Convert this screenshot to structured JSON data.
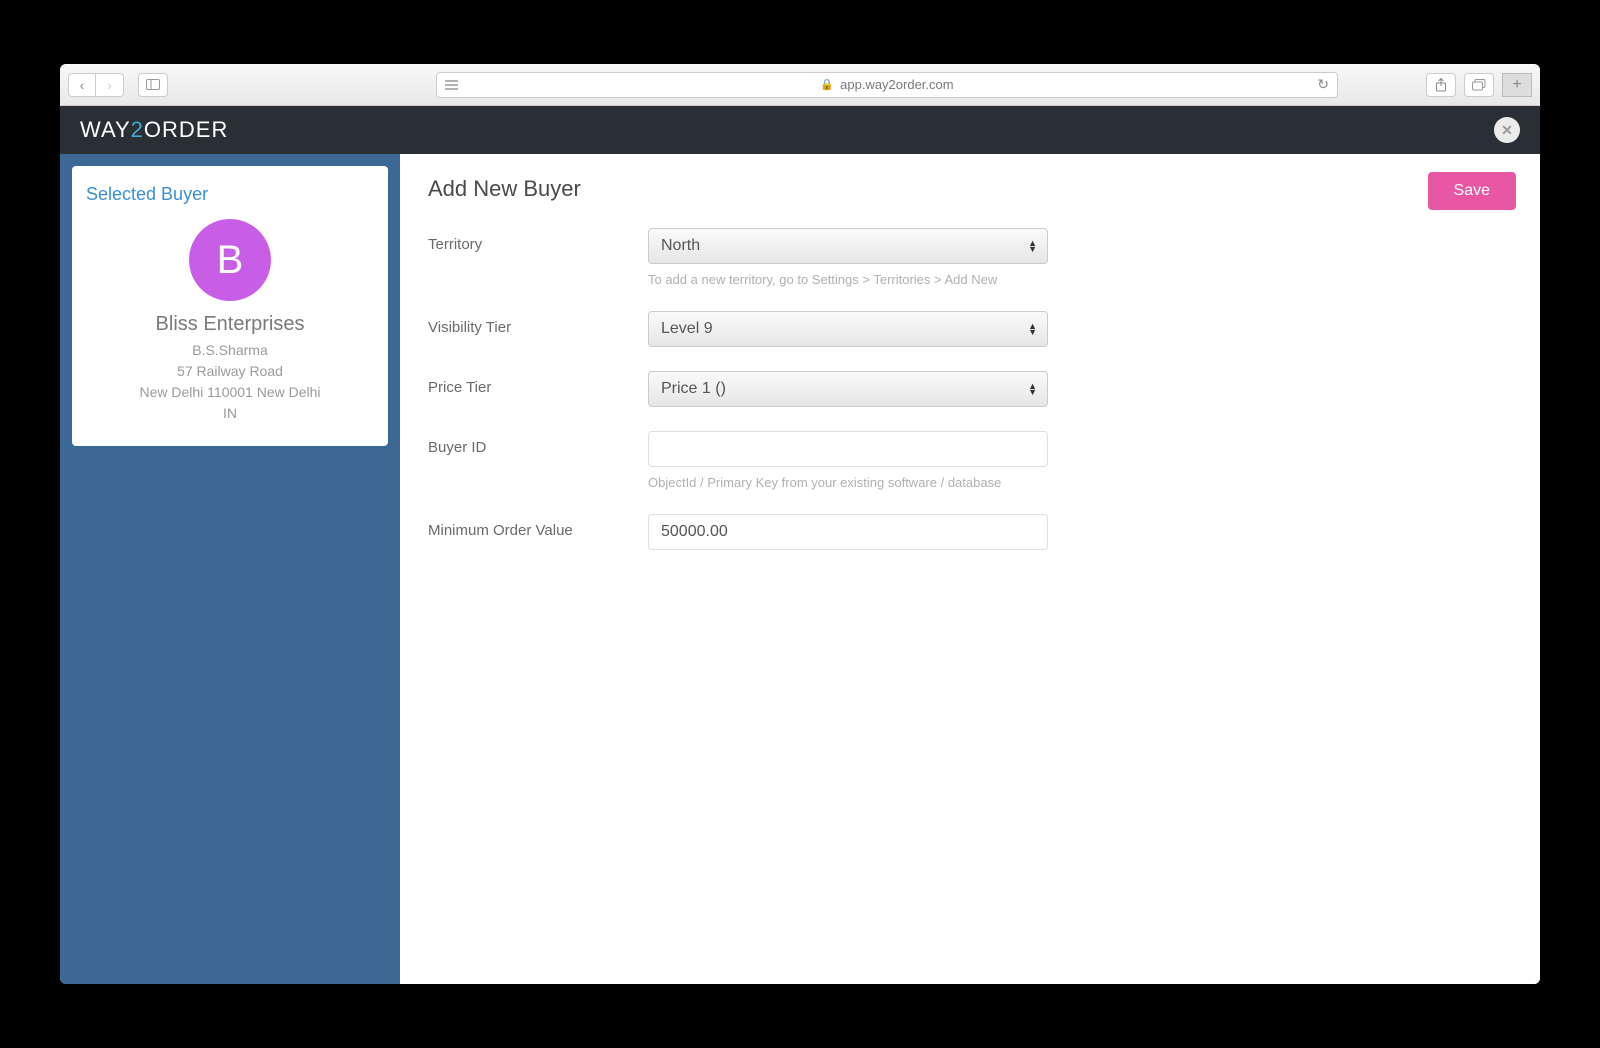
{
  "browser": {
    "url": "app.way2order.com"
  },
  "logo": {
    "part1": "WAY",
    "part2": "2",
    "part3": "ORDER"
  },
  "sidebar": {
    "card_title": "Selected Buyer",
    "avatar_initial": "B",
    "company": "Bliss Enterprises",
    "contact": "B.S.Sharma",
    "address1": "57 Railway Road",
    "address2": "New Delhi 110001 New Delhi",
    "country": "IN"
  },
  "page": {
    "title": "Add New Buyer",
    "save_label": "Save"
  },
  "form": {
    "territory": {
      "label": "Territory",
      "value": "North",
      "hint": "To add a new territory, go to Settings > Territories > Add New"
    },
    "visibility": {
      "label": "Visibility Tier",
      "value": "Level 9"
    },
    "price_tier": {
      "label": "Price Tier",
      "value": "Price 1 ()"
    },
    "buyer_id": {
      "label": "Buyer ID",
      "value": "",
      "hint": "ObjectId / Primary Key from your existing software / database"
    },
    "min_order": {
      "label": "Minimum Order Value",
      "value": "50000.00"
    }
  }
}
